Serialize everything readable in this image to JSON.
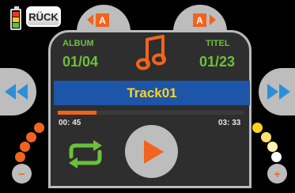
{
  "status": {
    "battery_icon": "battery-icon"
  },
  "header": {
    "back_label": "RÜCK",
    "album_tab": {
      "label": "A",
      "icon": "chevron-left-icon"
    },
    "title_tab": {
      "label": "A",
      "icon": "chevron-right-icon"
    }
  },
  "player": {
    "album_label": "ALBUM",
    "album_value": "01/04",
    "title_label": "TITEL",
    "title_value": "01/23",
    "music_icon": "music-note-icon",
    "track_name": "Track01",
    "elapsed": "00: 45",
    "duration": "03: 33",
    "progress_percent": 21,
    "repeat_icon": "repeat-icon",
    "play_icon": "play-icon"
  },
  "controls": {
    "prev_icon": "skip-back-icon",
    "next_icon": "skip-forward-icon",
    "minus_label": "−",
    "plus_label": "+",
    "volume_left_colors": [
      "#f0641e",
      "#f0641e",
      "#f0641e",
      "#f0641e"
    ],
    "volume_right_colors": [
      "#ffd21a",
      "#ffe070",
      "#fff2b0",
      "#ffffff"
    ]
  },
  "colors": {
    "accent": "#f0641e",
    "green": "#6cc03a",
    "blue": "#1d55a8",
    "yellow": "#ffd21a"
  }
}
